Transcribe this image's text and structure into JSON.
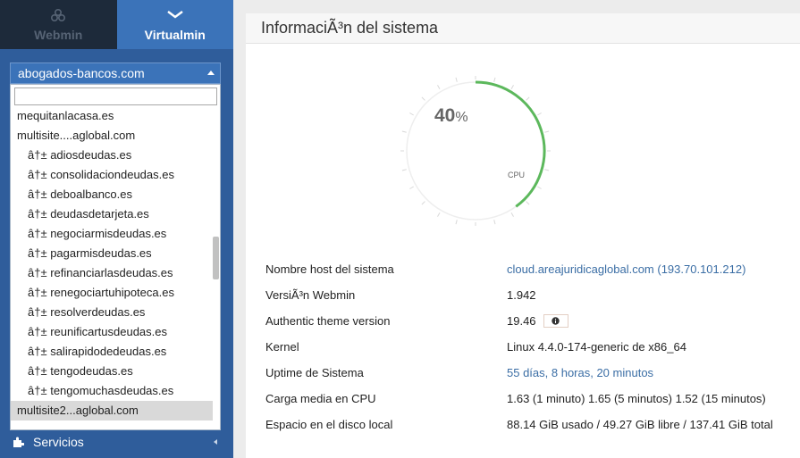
{
  "nav": {
    "webmin_label": "Webmin",
    "virtualmin_label": "Virtualmin"
  },
  "domain_selector": {
    "selected": "abogados-bancos.com",
    "options": [
      {
        "label": "mequitanlacasa.es",
        "child": false
      },
      {
        "label": "multisite....aglobal.com",
        "child": false
      },
      {
        "label": "â†± adiosdeudas.es",
        "child": true
      },
      {
        "label": "â†± consolidaciondeudas.es",
        "child": true
      },
      {
        "label": "â†± deboalbanco.es",
        "child": true
      },
      {
        "label": "â†± deudasdetarjeta.es",
        "child": true
      },
      {
        "label": "â†± negociarmisdeudas.es",
        "child": true
      },
      {
        "label": "â†± pagarmisdeudas.es",
        "child": true
      },
      {
        "label": "â†± refinanciarlasdeudas.es",
        "child": true
      },
      {
        "label": "â†± renegociartuhipoteca.es",
        "child": true
      },
      {
        "label": "â†± resolverdeudas.es",
        "child": true
      },
      {
        "label": "â†± reunificartusdeudas.es",
        "child": true
      },
      {
        "label": "â†± salirapidodedeudas.es",
        "child": true
      },
      {
        "label": "â†± tengodeudas.es",
        "child": true
      },
      {
        "label": "â†± tengomuchasdeudas.es",
        "child": true
      },
      {
        "label": "multisite2...aglobal.com",
        "child": false,
        "highlighted": true
      }
    ]
  },
  "sidebar": {
    "servicios_label": "Servicios"
  },
  "main": {
    "title": "InformaciÃ³n del sistema",
    "cpu_gauge": {
      "value": 40,
      "unit": "%",
      "label": "CPU"
    },
    "info_rows": [
      {
        "key": "Nombre host del sistema",
        "value": "cloud.areajuridicaglobal.com (193.70.101.212)",
        "link": true
      },
      {
        "key": "VersiÃ³n Webmin",
        "value": "1.942",
        "link": false
      },
      {
        "key": "Authentic theme version",
        "value": "19.46",
        "link": false,
        "info_button": true
      },
      {
        "key": "Kernel",
        "value": "Linux 4.4.0-174-generic de x86_64",
        "link": false
      },
      {
        "key": "Uptime de Sistema",
        "value": "55 días, 8 horas, 20 minutos",
        "link": true
      },
      {
        "key": "Carga media en CPU",
        "value": "1.63 (1 minuto) 1.65 (5 minutos) 1.52 (15 minutos)",
        "link": false
      },
      {
        "key": "Espacio en el disco local",
        "value": "88.14 GiB usado / 49.27 GiB libre / 137.41 GiB total",
        "link": false
      }
    ]
  },
  "colors": {
    "sidebar": "#2f5d9b",
    "gauge_fill": "#5cb85c",
    "link": "#3b6ea5"
  }
}
